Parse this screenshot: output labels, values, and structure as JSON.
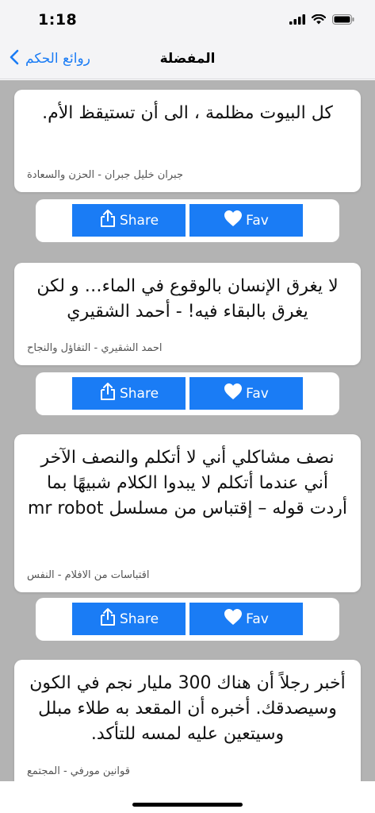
{
  "status_bar": {
    "time": "1:18"
  },
  "nav": {
    "back_label": "روائع الحكم",
    "title": "المفضلة"
  },
  "buttons": {
    "share_label": "Share",
    "fav_label": "Fav"
  },
  "quotes": [
    {
      "text": "كل البيوت مظلمة ، الى أن تستيقظ الأم.",
      "meta": "جبران خليل جبران  -  الحزن والسعادة"
    },
    {
      "text": "لا يغرق الإنسان بالوقوع في الماء… و لكن يغرق بالبقاء فيه! - أحمد الشقيري",
      "meta": "احمد الشقيري  -  التفاؤل والنجاح"
    },
    {
      "text": "نصف مشاكلي أني لا أتكلم والنصف الآخر أني عندما أتكلم لا يبدوا الكلام شبيهًا بما أردت قوله – إقتباس من مسلسل mr robot",
      "meta": "اقتباسات من الافلام  -  النفس"
    },
    {
      "text": "أخبر رجلاً أن هناك 300 مليار نجم في الكون وسيصدقك. أخبره أن المقعد به طلاء مبلل وسيتعين عليه لمسه للتأكد.",
      "meta": "قوانين مورفي  -  المجتمع"
    }
  ],
  "colors": {
    "accent": "#1a7cf5",
    "background": "#b3b3b3",
    "card": "#ffffff"
  }
}
